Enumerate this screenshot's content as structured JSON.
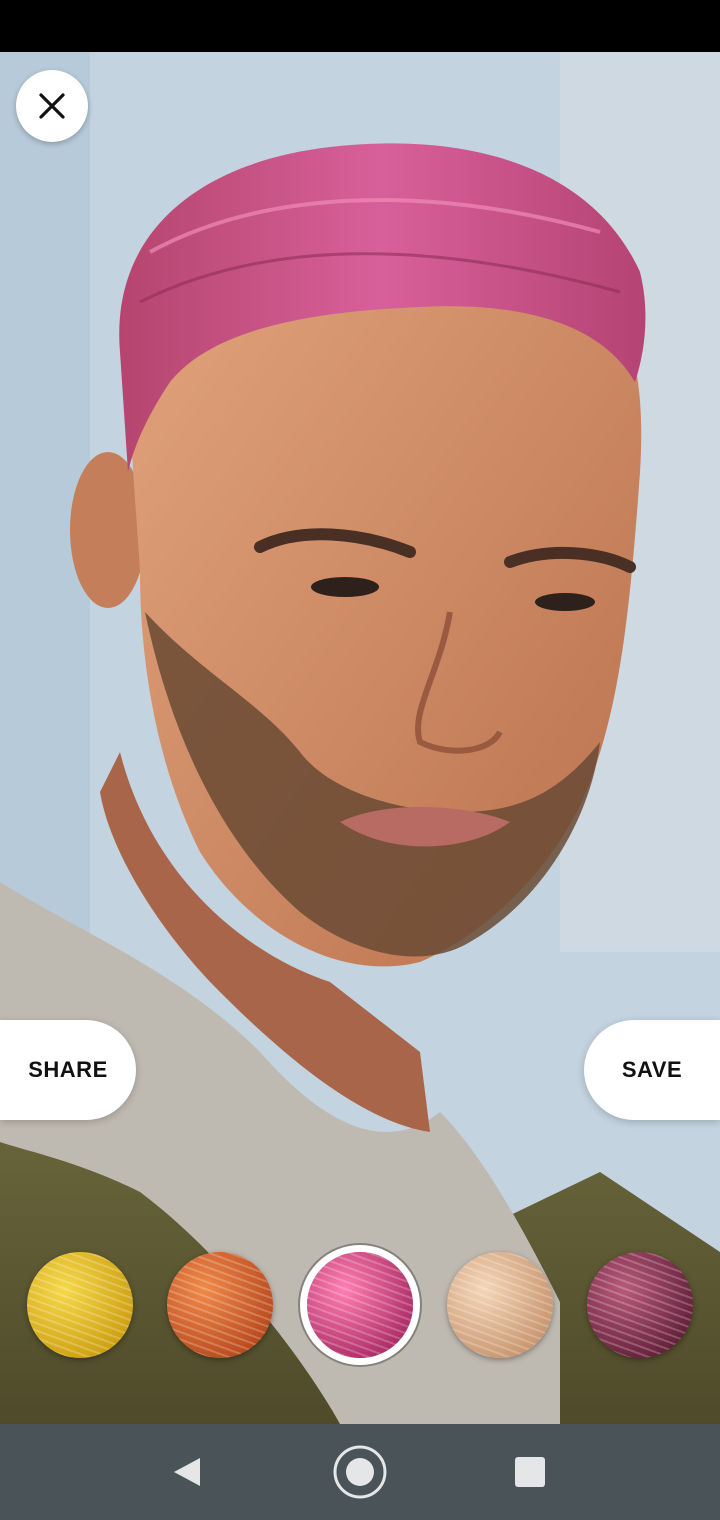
{
  "actions": {
    "share_label": "SHARE",
    "save_label": "SAVE"
  },
  "icons": {
    "close": "close-icon",
    "back": "back-triangle-icon",
    "home": "home-circle-icon",
    "recents": "recents-square-icon"
  },
  "swatches": [
    {
      "name": "golden-blonde",
      "colors": [
        "#f5d84a",
        "#c99a0c"
      ]
    },
    {
      "name": "copper",
      "colors": [
        "#f08a4a",
        "#b3431a"
      ]
    },
    {
      "name": "magenta-pink",
      "colors": [
        "#ff7fb2",
        "#a3245f"
      ],
      "selected": true
    },
    {
      "name": "light-beige",
      "colors": [
        "#f4d6b8",
        "#c48f68"
      ]
    },
    {
      "name": "burgundy",
      "colors": [
        "#b85a7a",
        "#5b1a33"
      ]
    }
  ],
  "colors": {
    "nav_bar": "#4a5358",
    "pill": "#ffffff",
    "accent": "#d24d8c"
  }
}
